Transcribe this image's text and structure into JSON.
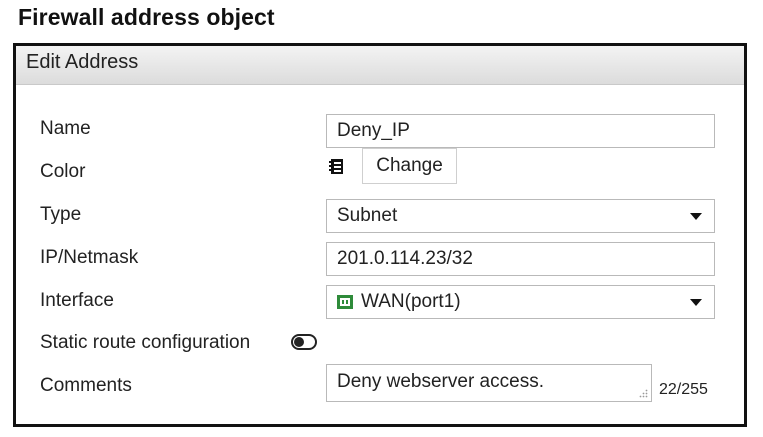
{
  "page": {
    "title": "Firewall address object"
  },
  "dialog": {
    "header": "Edit Address",
    "fields": {
      "name": {
        "label": "Name",
        "value": "Deny_IP"
      },
      "color": {
        "label": "Color",
        "button_label": "Change",
        "icon": "color-swatch-icon"
      },
      "type": {
        "label": "Type",
        "value": "Subnet"
      },
      "ip_netmask": {
        "label": "IP/Netmask",
        "value": "201.0.114.23/32"
      },
      "interface": {
        "label": "Interface",
        "value": "WAN(port1)",
        "icon": "network-port-icon",
        "icon_color": "#2e8b3a"
      },
      "static_route": {
        "label": "Static route configuration",
        "enabled": false
      },
      "comments": {
        "label": "Comments",
        "value": "Deny webserver access.",
        "counter": "22/255"
      }
    }
  }
}
